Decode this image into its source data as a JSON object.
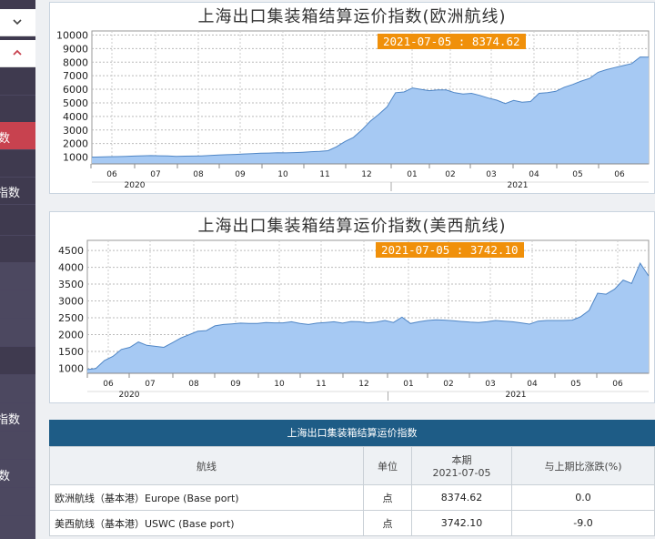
{
  "sidebar": {
    "items": [
      {
        "label": "数"
      },
      {
        "label": "指数"
      },
      {
        "label": "指数"
      },
      {
        "label": "数"
      }
    ]
  },
  "chart_data": [
    {
      "type": "area",
      "title": "上海出口集装箱结算运价指数(欧洲航线)",
      "tooltip": "2021-07-05 : 8374.62",
      "yticks": [
        1000,
        2000,
        3000,
        4000,
        5000,
        6000,
        7000,
        8000,
        9000,
        10000
      ],
      "ylim": [
        500,
        10300
      ],
      "month_labels": [
        "06",
        "07",
        "08",
        "09",
        "10",
        "11",
        "12",
        "01",
        "02",
        "03",
        "04",
        "05",
        "06"
      ],
      "year_labels": [
        "2020",
        "2021"
      ],
      "grid": true,
      "color": "#a6c9f3",
      "values": [
        1000,
        1010,
        1030,
        1040,
        1050,
        1080,
        1100,
        1110,
        1100,
        1090,
        1060,
        1070,
        1080,
        1090,
        1120,
        1150,
        1180,
        1200,
        1230,
        1260,
        1290,
        1300,
        1320,
        1310,
        1330,
        1360,
        1400,
        1420,
        1470,
        1760,
        2150,
        2450,
        3000,
        3650,
        4150,
        4700,
        5750,
        5800,
        6100,
        6000,
        5900,
        5950,
        5950,
        5750,
        5650,
        5700,
        5550,
        5350,
        5200,
        4950,
        5180,
        5050,
        5100,
        5700,
        5750,
        5850,
        6150,
        6350,
        6600,
        6800,
        7250,
        7450,
        7600,
        7750,
        7900,
        8380,
        8374.62
      ]
    },
    {
      "type": "area",
      "title": "上海出口集装箱结算运价指数(美西航线)",
      "tooltip": "2021-07-05 : 3742.10",
      "yticks": [
        1000,
        1500,
        2000,
        2500,
        3000,
        3500,
        4000,
        4500
      ],
      "ylim": [
        850,
        4800
      ],
      "month_labels": [
        "06",
        "07",
        "08",
        "09",
        "10",
        "11",
        "12",
        "01",
        "02",
        "03",
        "04",
        "05",
        "06"
      ],
      "year_labels": [
        "2020",
        "2021"
      ],
      "grid": true,
      "color": "#a6c9f3",
      "values": [
        960,
        990,
        1230,
        1350,
        1560,
        1620,
        1780,
        1680,
        1650,
        1620,
        1760,
        1900,
        2000,
        2100,
        2120,
        2260,
        2300,
        2320,
        2340,
        2330,
        2330,
        2360,
        2350,
        2350,
        2380,
        2330,
        2300,
        2340,
        2360,
        2380,
        2340,
        2390,
        2380,
        2350,
        2370,
        2420,
        2360,
        2520,
        2330,
        2380,
        2420,
        2440,
        2430,
        2410,
        2390,
        2370,
        2360,
        2380,
        2420,
        2400,
        2380,
        2350,
        2310,
        2400,
        2420,
        2420,
        2420,
        2430,
        2530,
        2720,
        3230,
        3200,
        3350,
        3620,
        3520,
        4120,
        3742.1
      ]
    }
  ],
  "table": {
    "title": "上海出口集装箱结算运价指数",
    "headers": {
      "route": "航线",
      "unit": "单位",
      "current_1": "本期",
      "current_2": "2021-07-05",
      "change": "与上期比涨跌(%)"
    },
    "rows": [
      {
        "route": "欧洲航线（基本港）Europe (Base port)",
        "unit": "点",
        "value": "8374.62",
        "change": "0.0"
      },
      {
        "route": "美西航线（基本港）USWC (Base port)",
        "unit": "点",
        "value": "3742.10",
        "change": "-9.0"
      }
    ]
  }
}
